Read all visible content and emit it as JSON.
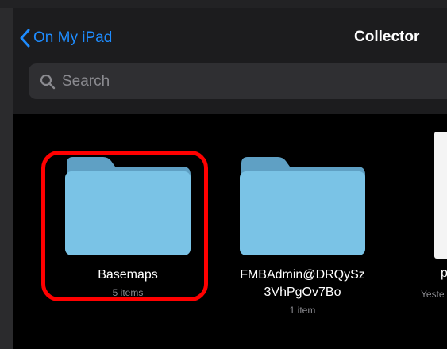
{
  "nav": {
    "back_label": "On My iPad",
    "title": "Collector"
  },
  "search": {
    "placeholder": "Search"
  },
  "folders": [
    {
      "name": "Basemaps",
      "meta": "5 items"
    },
    {
      "name_line1": "FMBAdmin@DRQySz",
      "name_line2": "3VhPgOv7Bo",
      "meta": "1 item"
    }
  ],
  "partial_item": {
    "name_fragment": "p",
    "meta_fragment": "Yeste"
  },
  "colors": {
    "accent": "#1e8cff",
    "folder_blue": "#7ac3e6",
    "highlight": "#ff0000"
  }
}
